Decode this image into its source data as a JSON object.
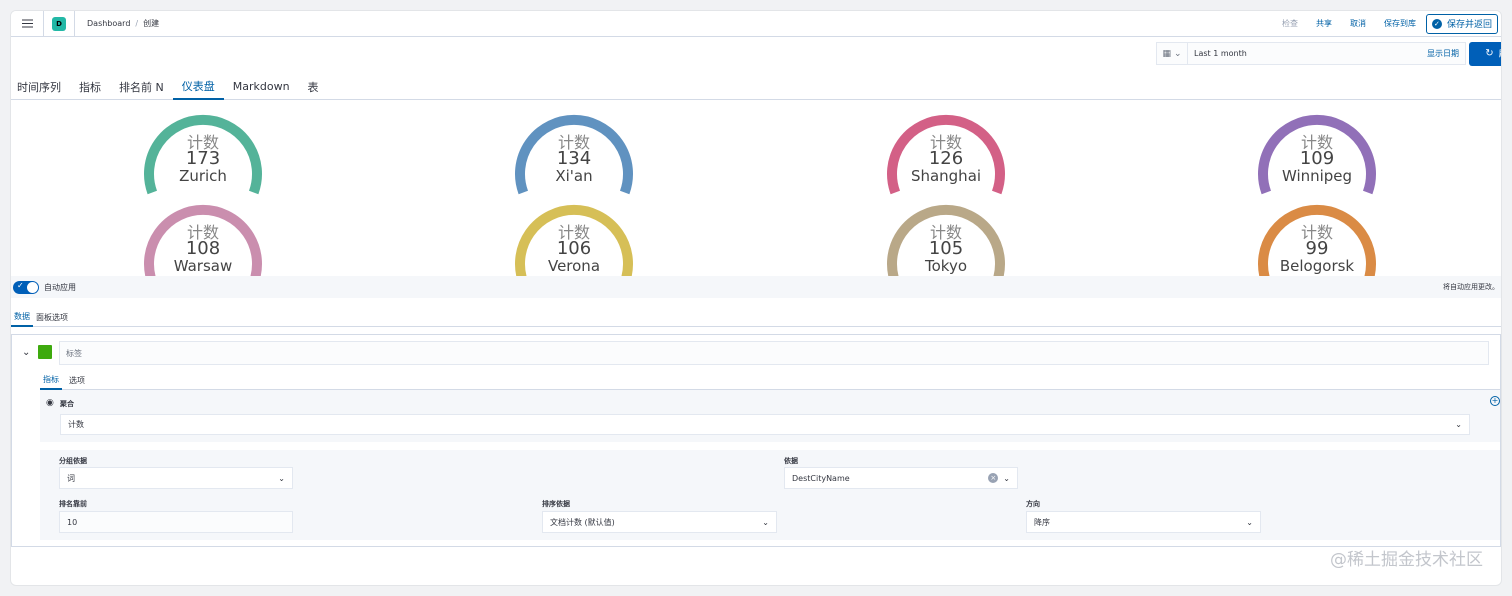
{
  "header": {
    "space_initial": "D",
    "breadcrumb_parent": "Dashboard",
    "breadcrumb_sep": "/",
    "breadcrumb_current": "创建",
    "actions": {
      "inspect": "检查",
      "share": "共享",
      "cancel": "取消",
      "save_to_library": "保存到库"
    },
    "save_and_return": "保存并返回"
  },
  "querybar": {
    "date_icon": "calendar-icon",
    "date_value": "Last 1 month",
    "show_dates": "显示日期",
    "refresh_label": "刷新"
  },
  "vis_tabs": [
    "时间序列",
    "指标",
    "排名前 N",
    "仪表盘",
    "Markdown",
    "表"
  ],
  "active_vis_tab": "仪表盘",
  "gauges": [
    {
      "label": "计数",
      "value": "173",
      "city": "Zurich",
      "color": "#54b399"
    },
    {
      "label": "计数",
      "value": "134",
      "city": "Xi'an",
      "color": "#6092c0"
    },
    {
      "label": "计数",
      "value": "126",
      "city": "Shanghai",
      "color": "#d36086"
    },
    {
      "label": "计数",
      "value": "109",
      "city": "Winnipeg",
      "color": "#9170b8"
    },
    {
      "label": "计数",
      "value": "108",
      "city": "Warsaw",
      "color": "#ca8eae"
    },
    {
      "label": "计数",
      "value": "106",
      "city": "Verona",
      "color": "#d6bf57"
    },
    {
      "label": "计数",
      "value": "105",
      "city": "Tokyo",
      "color": "#b9a888"
    },
    {
      "label": "计数",
      "value": "99",
      "city": "Belogorsk",
      "color": "#da8b45"
    }
  ],
  "autobar": {
    "label": "自动应用",
    "hint": "将自动应用更改。"
  },
  "side_tabs": [
    "数据",
    "面板选项"
  ],
  "series": {
    "label_placeholder": "标签",
    "inner_tabs": [
      "指标",
      "选项"
    ],
    "metric": {
      "title": "聚合",
      "value": "计数"
    },
    "group_by": {
      "label": "分组依据",
      "value": "词"
    },
    "by": {
      "label": "依据",
      "value": "DestCityName"
    },
    "top": {
      "label": "排名靠前",
      "value": "10"
    },
    "order_by": {
      "label": "排序依据",
      "value": "文档计数 (默认值)"
    },
    "direction": {
      "label": "方向",
      "value": "降序"
    }
  },
  "watermark": "@稀土掘金技术社区"
}
